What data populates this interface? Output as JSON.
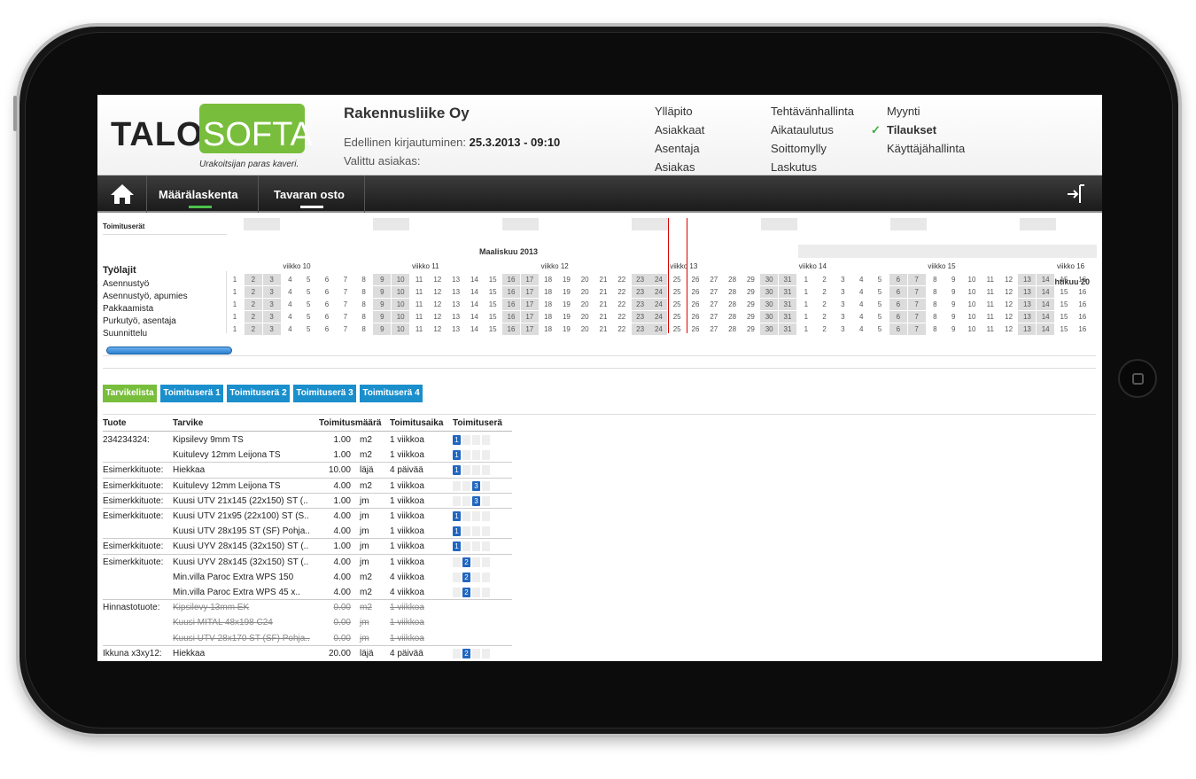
{
  "header": {
    "logo": {
      "talo": "TALO",
      "softa": "SOFTA",
      "tagline": "Urakoitsijan paras kaveri."
    },
    "company": "Rakennusliike Oy",
    "last_login_label": "Edellinen kirjautuminen:",
    "last_login_value": "25.3.2013 - 09:10",
    "client_label": "Valittu asiakas:",
    "menu": {
      "col1": [
        "Ylläpito",
        "Asiakkaat",
        "Asentaja",
        "Asiakas"
      ],
      "col2": [
        "Tehtävänhallinta",
        "Aikataulutus",
        "Soittomylly",
        "Laskutus"
      ],
      "col3": [
        "Myynti",
        "Tilaukset",
        "Käyttäjähallinta"
      ],
      "active": "Tilaukset"
    }
  },
  "nav": {
    "tabs": [
      {
        "label": "Määrälaskenta",
        "indicator": "#4cc24c"
      },
      {
        "label": "Tavaran osto",
        "indicator": "#ffffff"
      }
    ]
  },
  "schedule": {
    "toimituserat_label": "Toimituserät",
    "month1": "Maaliskuu 2013",
    "month2": "Huhtikuu 20",
    "tyolajit_label": "Työlajit",
    "work_types": [
      "Asennustyö",
      "Asennustyö, apumies",
      "Pakkaamista",
      "Purkutyö, asentaja",
      "Suunnittelu"
    ],
    "weeks": [
      "viikko 10",
      "viikko 11",
      "viikko 12",
      "viikko 13",
      "viikko 14",
      "viikko 15",
      "viikko 16"
    ],
    "march_days": [
      1,
      2,
      3,
      4,
      5,
      6,
      7,
      8,
      9,
      10,
      11,
      12,
      13,
      14,
      15,
      16,
      17,
      18,
      19,
      20,
      21,
      22,
      23,
      24,
      25,
      26,
      27,
      28,
      29,
      30,
      31
    ],
    "april_days": [
      1,
      2,
      3,
      4,
      5,
      6,
      7,
      8,
      9,
      10,
      11,
      12,
      13,
      14,
      15,
      16
    ],
    "march_weekends": [
      2,
      3,
      9,
      10,
      16,
      17,
      23,
      24,
      30,
      31
    ],
    "april_weekends": [
      6,
      7,
      13,
      14
    ],
    "today_march": 25
  },
  "tabs": [
    {
      "label": "Tarvikelista",
      "color": "#78be3c"
    },
    {
      "label": "Toimituserä 1",
      "color": "#1a8fcc"
    },
    {
      "label": "Toimituserä 2",
      "color": "#1a8fcc"
    },
    {
      "label": "Toimituserä 3",
      "color": "#1a8fcc"
    },
    {
      "label": "Toimituserä 4",
      "color": "#1a8fcc"
    }
  ],
  "table": {
    "headers": {
      "tuote": "Tuote",
      "tarvike": "Tarvike",
      "maara": "Toimitusmäärä",
      "aika": "Toimitusaika",
      "era": "Toimituserä"
    },
    "rows": [
      {
        "tuote": "234234324:",
        "tarvike": "Kipsilevy 9mm TS",
        "maara": "1.00",
        "yks": "m2",
        "aika": "1 viikkoa",
        "era": 1
      },
      {
        "tuote": "",
        "tarvike": "Kuitulevy 12mm Leijona TS",
        "maara": "1.00",
        "yks": "m2",
        "aika": "1 viikkoa",
        "era": 1
      },
      {
        "tuote": "Esimerkkituote:",
        "tarvike": "Hiekkaa",
        "maara": "10.00",
        "yks": "läjä",
        "aika": "4 päivää",
        "era": 1
      },
      {
        "tuote": "Esimerkkituote:",
        "tarvike": "Kuitulevy 12mm Leijona TS",
        "maara": "4.00",
        "yks": "m2",
        "aika": "1 viikkoa",
        "era": 3
      },
      {
        "tuote": "Esimerkkituote:",
        "tarvike": "Kuusi UTV 21x145 (22x150) ST (..",
        "maara": "1.00",
        "yks": "jm",
        "aika": "1 viikkoa",
        "era": 3
      },
      {
        "tuote": "Esimerkkituote:",
        "tarvike": "Kuusi UTV 21x95 (22x100) ST (S..",
        "maara": "4.00",
        "yks": "jm",
        "aika": "1 viikkoa",
        "era": 1
      },
      {
        "tuote": "",
        "tarvike": "Kuusi UTV 28x195 ST (SF) Pohja..",
        "maara": "4.00",
        "yks": "jm",
        "aika": "1 viikkoa",
        "era": 1
      },
      {
        "tuote": "Esimerkkituote:",
        "tarvike": "Kuusi UYV 28x145 (32x150) ST (..",
        "maara": "1.00",
        "yks": "jm",
        "aika": "1 viikkoa",
        "era": 1
      },
      {
        "tuote": "Esimerkkituote:",
        "tarvike": "Kuusi UYV 28x145 (32x150) ST (..",
        "maara": "4.00",
        "yks": "jm",
        "aika": "1 viikkoa",
        "era": 2
      },
      {
        "tuote": "",
        "tarvike": "Min.villa Paroc Extra WPS 150",
        "maara": "4.00",
        "yks": "m2",
        "aika": "4 viikkoa",
        "era": 2
      },
      {
        "tuote": "",
        "tarvike": "Min.villa Paroc Extra WPS 45 x..",
        "maara": "4.00",
        "yks": "m2",
        "aika": "4 viikkoa",
        "era": 2
      },
      {
        "tuote": "Hinnastotuote:",
        "tarvike": "Kipsilevy 13mm EK",
        "maara": "0.00",
        "yks": "m2",
        "aika": "1 viikkoa",
        "era": 0,
        "strike": true
      },
      {
        "tuote": "",
        "tarvike": "Kuusi MITAL 48x198 C24",
        "maara": "0.00",
        "yks": "jm",
        "aika": "1 viikkoa",
        "era": 0,
        "strike": true
      },
      {
        "tuote": "",
        "tarvike": "Kuusi UTV 28x170 ST (SF) Pohja..",
        "maara": "0.00",
        "yks": "jm",
        "aika": "1 viikkoa",
        "era": 0,
        "strike": true
      },
      {
        "tuote": "Ikkuna x3xy12:",
        "tarvike": "Hiekkaa",
        "maara": "20.00",
        "yks": "läjä",
        "aika": "4 päivää",
        "era": 2
      }
    ]
  }
}
